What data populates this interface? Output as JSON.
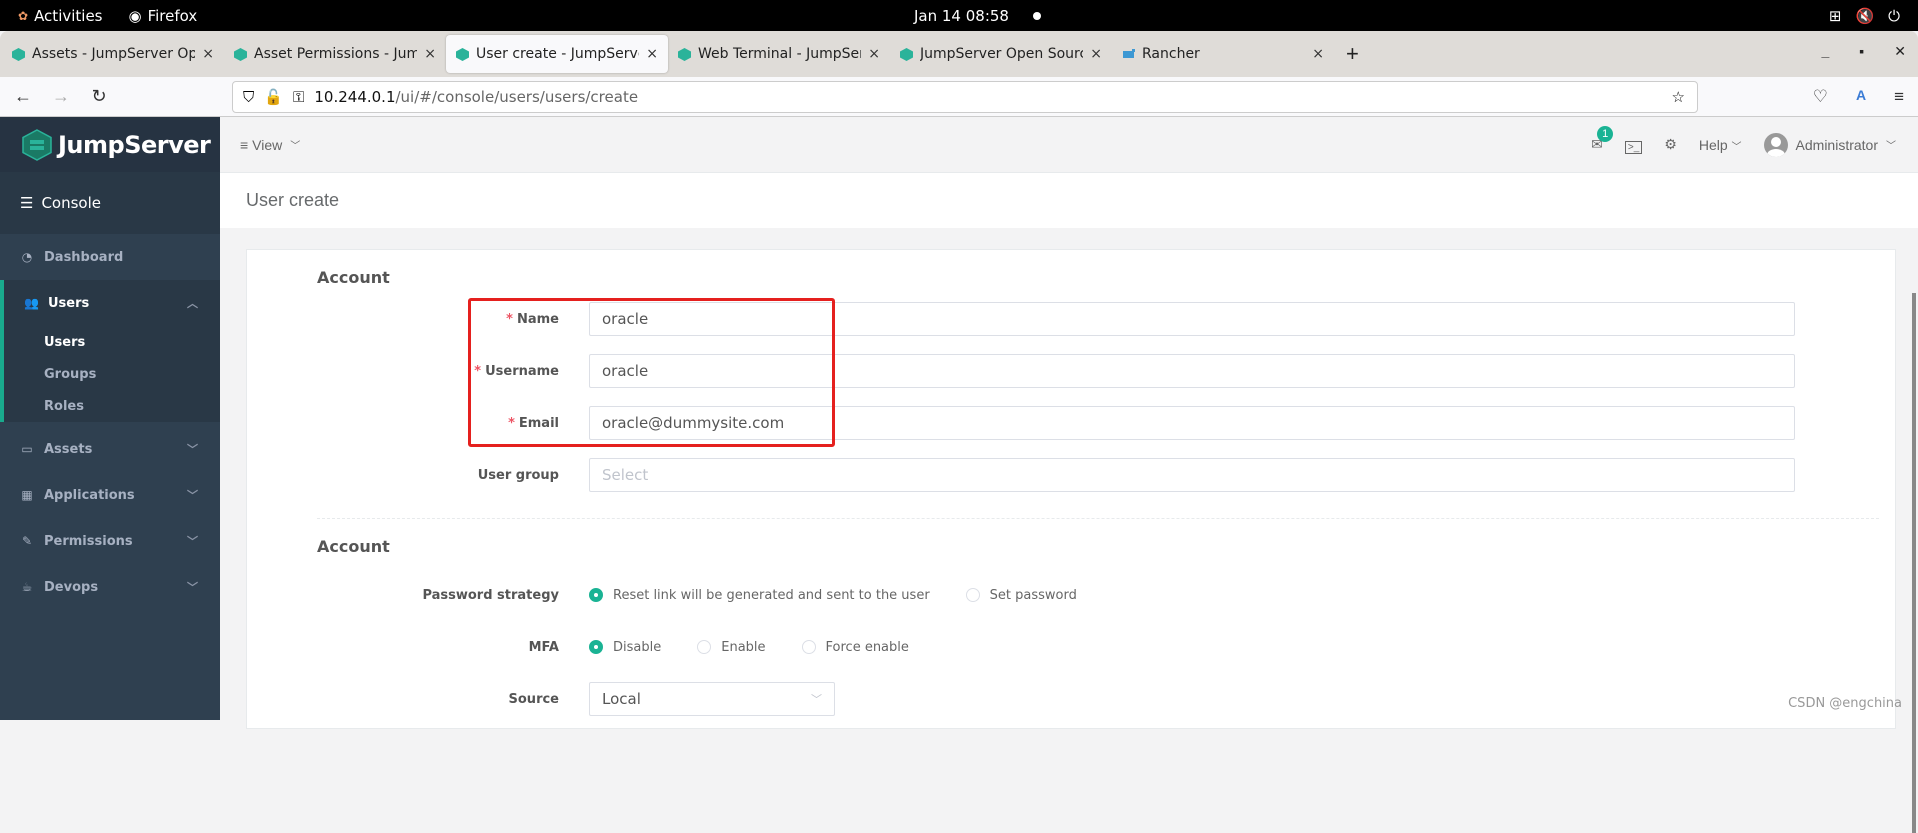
{
  "system": {
    "activities": "Activities",
    "app": "Firefox",
    "clock": "Jan 14  08:58"
  },
  "browser": {
    "tabs": [
      {
        "title": "Assets - JumpServer Open",
        "active": false
      },
      {
        "title": "Asset Permissions - Jump",
        "active": false
      },
      {
        "title": "User create - JumpServer",
        "active": true
      },
      {
        "title": "Web Terminal - JumpServ",
        "active": false
      },
      {
        "title": "JumpServer Open Source",
        "active": false
      },
      {
        "title": "Rancher",
        "active": false
      }
    ],
    "url_host": "10.244.0.1",
    "url_path": "/ui/#/console/users/users/create"
  },
  "sidebar": {
    "logo": "JumpServer",
    "console": "Console",
    "items": [
      {
        "label": "Dashboard",
        "icon": "dashboard-icon"
      },
      {
        "label": "Users",
        "icon": "users-icon",
        "expanded": true,
        "children": [
          {
            "label": "Users",
            "active": true
          },
          {
            "label": "Groups"
          },
          {
            "label": "Roles"
          }
        ]
      },
      {
        "label": "Assets",
        "icon": "inbox-icon"
      },
      {
        "label": "Applications",
        "icon": "grid-icon"
      },
      {
        "label": "Permissions",
        "icon": "edit-icon"
      },
      {
        "label": "Devops",
        "icon": "coffee-icon"
      }
    ]
  },
  "header": {
    "view": "View",
    "badge_count": "1",
    "help": "Help",
    "user": "Administrator"
  },
  "page": {
    "title": "User create",
    "section1": "Account",
    "section2": "Account",
    "fields": {
      "name_label": "Name",
      "name_value": "oracle",
      "username_label": "Username",
      "username_value": "oracle",
      "email_label": "Email",
      "email_value": "oracle@dummysite.com",
      "group_label": "User group",
      "group_placeholder": "Select",
      "password_label": "Password strategy",
      "password_options": [
        "Reset link will be generated and sent to the user",
        "Set password"
      ],
      "password_selected": 0,
      "mfa_label": "MFA",
      "mfa_options": [
        "Disable",
        "Enable",
        "Force enable"
      ],
      "mfa_selected": 0,
      "source_label": "Source",
      "source_value": "Local"
    }
  },
  "watermark": "CSDN @engchina",
  "colors": {
    "accent": "#1ab394",
    "sidebar": "#2f4050",
    "highlight": "#e5201e"
  }
}
